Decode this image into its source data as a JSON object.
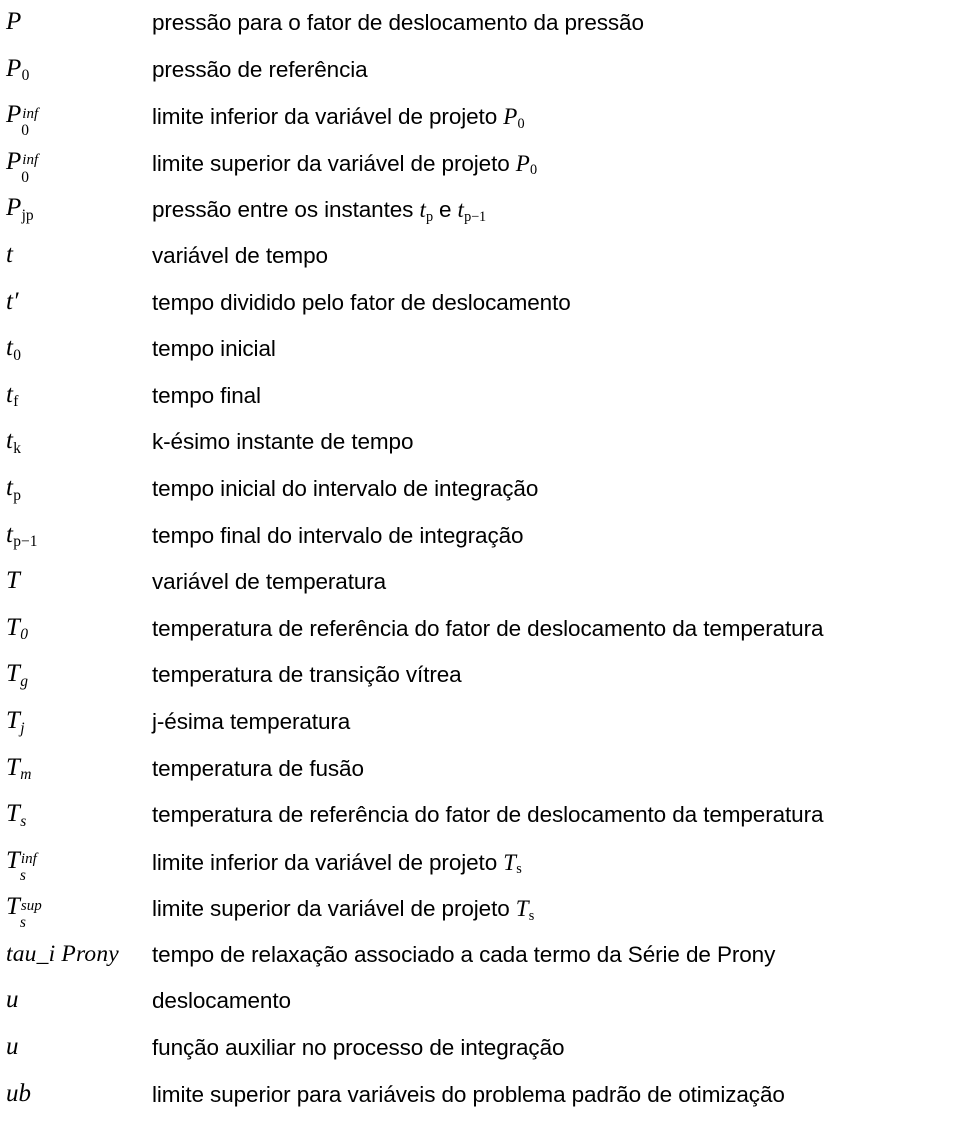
{
  "page": {
    "kind": "nomenclature-list",
    "language": "pt-BR",
    "text_color": "#000000",
    "background_color": "#ffffff"
  },
  "entries": [
    {
      "symbol_plain": "P",
      "base": "P",
      "sub": "",
      "sup": "",
      "description": "pressão para o fator de deslocamento da pressão",
      "desc_prefix": "pressão para o fator de deslocamento da pressão",
      "desc_math_base": "",
      "desc_math_sub": "",
      "desc_suffix": ""
    },
    {
      "symbol_plain": "P0",
      "base": "P",
      "sub": "0",
      "sup": "",
      "description": "pressão de referência",
      "desc_prefix": "pressão de referência",
      "desc_math_base": "",
      "desc_math_sub": "",
      "desc_suffix": ""
    },
    {
      "symbol_plain": "P0^inf",
      "base": "P",
      "sub": "0",
      "sup": "inf",
      "description": "limite inferior da variável de projeto P0",
      "desc_prefix": "limite inferior da variável de projeto ",
      "desc_math_base": "P",
      "desc_math_sub": "0",
      "desc_suffix": ""
    },
    {
      "symbol_plain": "P0^inf",
      "base": "P",
      "sub": "0",
      "sup": "inf",
      "description": "limite superior da variável de projeto P0",
      "desc_prefix": "limite superior da variável de projeto ",
      "desc_math_base": "P",
      "desc_math_sub": "0",
      "desc_suffix": ""
    },
    {
      "symbol_plain": "Pjp",
      "base": "P",
      "sub": "jp",
      "sup": "",
      "description": "pressão entre os instantes tp e tp−1",
      "desc_prefix": "pressão entre os instantes ",
      "desc_math_base": "t",
      "desc_math_sub": "p",
      "desc_mid": " e  ",
      "desc_math2_base": "t",
      "desc_math2_sub": "p−1",
      "desc_suffix": ""
    },
    {
      "symbol_plain": "t",
      "base": "t",
      "sub": "",
      "sup": "",
      "description": "variável de tempo",
      "desc_prefix": "variável de tempo",
      "desc_math_base": "",
      "desc_math_sub": "",
      "desc_suffix": ""
    },
    {
      "symbol_plain": "t′",
      "base": "t′",
      "sub": "",
      "sup": "",
      "description": "tempo dividido pelo fator de deslocamento",
      "desc_prefix": "tempo dividido pelo fator de deslocamento",
      "desc_math_base": "",
      "desc_math_sub": "",
      "desc_suffix": ""
    },
    {
      "symbol_plain": "t0",
      "base": "t",
      "sub": "0",
      "sup": "",
      "description": "tempo inicial",
      "desc_prefix": "tempo inicial",
      "desc_math_base": "",
      "desc_math_sub": "",
      "desc_suffix": ""
    },
    {
      "symbol_plain": "tf",
      "base": "t",
      "sub": "f",
      "sup": "",
      "description": "tempo final",
      "desc_prefix": "tempo final",
      "desc_math_base": "",
      "desc_math_sub": "",
      "desc_suffix": ""
    },
    {
      "symbol_plain": "tk",
      "base": "t",
      "sub": "k",
      "sup": "",
      "description": "k-ésimo instante de tempo",
      "desc_prefix": "k-ésimo instante de tempo",
      "desc_math_base": "",
      "desc_math_sub": "",
      "desc_suffix": ""
    },
    {
      "symbol_plain": "tp",
      "base": "t",
      "sub": "p",
      "sup": "",
      "description": "tempo inicial do intervalo de integração",
      "desc_prefix": "tempo inicial do intervalo de integração",
      "desc_math_base": "",
      "desc_math_sub": "",
      "desc_suffix": ""
    },
    {
      "symbol_plain": "tp−1",
      "base": "t",
      "sub": "p−1",
      "sup": "",
      "description": "tempo final do intervalo de integração",
      "desc_prefix": "tempo final do intervalo de integração",
      "desc_math_base": "",
      "desc_math_sub": "",
      "desc_suffix": ""
    },
    {
      "symbol_plain": "T",
      "base": "T",
      "sub": "",
      "sup": "",
      "description": "variável de temperatura",
      "desc_prefix": "variável de temperatura",
      "desc_math_base": "",
      "desc_math_sub": "",
      "desc_suffix": ""
    },
    {
      "symbol_plain": "T0",
      "base": "T",
      "sub": "0",
      "sub_italic": true,
      "sup": "",
      "description": "temperatura de referência do fator de deslocamento da temperatura",
      "desc_prefix": "temperatura de referência do fator de deslocamento da temperatura",
      "desc_math_base": "",
      "desc_math_sub": "",
      "desc_suffix": ""
    },
    {
      "symbol_plain": "Tg",
      "base": "T",
      "sub": "g",
      "sub_italic": true,
      "sup": "",
      "description": "temperatura de transição vítrea",
      "desc_prefix": "temperatura de transição vítrea",
      "desc_math_base": "",
      "desc_math_sub": "",
      "desc_suffix": ""
    },
    {
      "symbol_plain": "Tj",
      "base": "T",
      "sub": "j",
      "sub_italic": true,
      "sup": "",
      "description": "j-ésima temperatura",
      "desc_prefix": "j-ésima temperatura",
      "desc_math_base": "",
      "desc_math_sub": "",
      "desc_suffix": ""
    },
    {
      "symbol_plain": "Tm",
      "base": "T",
      "sub": "m",
      "sub_italic": true,
      "sup": "",
      "description": "temperatura de fusão",
      "desc_prefix": "temperatura de fusão",
      "desc_math_base": "",
      "desc_math_sub": "",
      "desc_suffix": ""
    },
    {
      "symbol_plain": "Ts",
      "base": "T",
      "sub": "s",
      "sub_italic": true,
      "sup": "",
      "description": "temperatura de referência do fator de deslocamento da temperatura",
      "desc_prefix": "temperatura de referência do fator de deslocamento da temperatura",
      "desc_math_base": "",
      "desc_math_sub": "",
      "desc_suffix": ""
    },
    {
      "symbol_plain": "Ts^inf",
      "base": "T",
      "sub": "s",
      "sub_italic": true,
      "sup": "inf",
      "description": "limite inferior da variável de projeto Ts",
      "desc_prefix": "limite inferior da variável de projeto ",
      "desc_math_base": "T",
      "desc_math_sub": "s",
      "desc_suffix": ""
    },
    {
      "symbol_plain": "Ts^sup",
      "base": "T",
      "sub": "s",
      "sub_italic": true,
      "sup": "sup",
      "description": "limite superior da variável de projeto Ts",
      "desc_prefix": "limite superior da variável de projeto ",
      "desc_math_base": "T",
      "desc_math_sub": "s",
      "desc_suffix": ""
    },
    {
      "symbol_plain": "tau_i Prony",
      "base": "tau_i Prony",
      "sub": "",
      "sup": "",
      "description": "tempo de relaxação associado a cada termo da Série de Prony",
      "desc_prefix": "tempo de relaxação associado a cada termo da Série de Prony",
      "desc_math_base": "",
      "desc_math_sub": "",
      "desc_suffix": ""
    },
    {
      "symbol_plain": "u",
      "base": "u",
      "sub": "",
      "sup": "",
      "description": "deslocamento",
      "desc_prefix": "deslocamento",
      "desc_math_base": "",
      "desc_math_sub": "",
      "desc_suffix": ""
    },
    {
      "symbol_plain": "u",
      "base": "u",
      "sub": "",
      "sup": "",
      "description": "função auxiliar no processo de integração",
      "desc_prefix": "função auxiliar no processo de integração",
      "desc_math_base": "",
      "desc_math_sub": "",
      "desc_suffix": ""
    },
    {
      "symbol_plain": "ub",
      "base": "ub",
      "sub": "",
      "sup": "",
      "description": "limite superior para variáveis do problema padrão de otimização",
      "desc_prefix": "limite superior para variáveis do problema padrão de otimização",
      "desc_math_base": "",
      "desc_math_sub": "",
      "desc_suffix": ""
    }
  ]
}
